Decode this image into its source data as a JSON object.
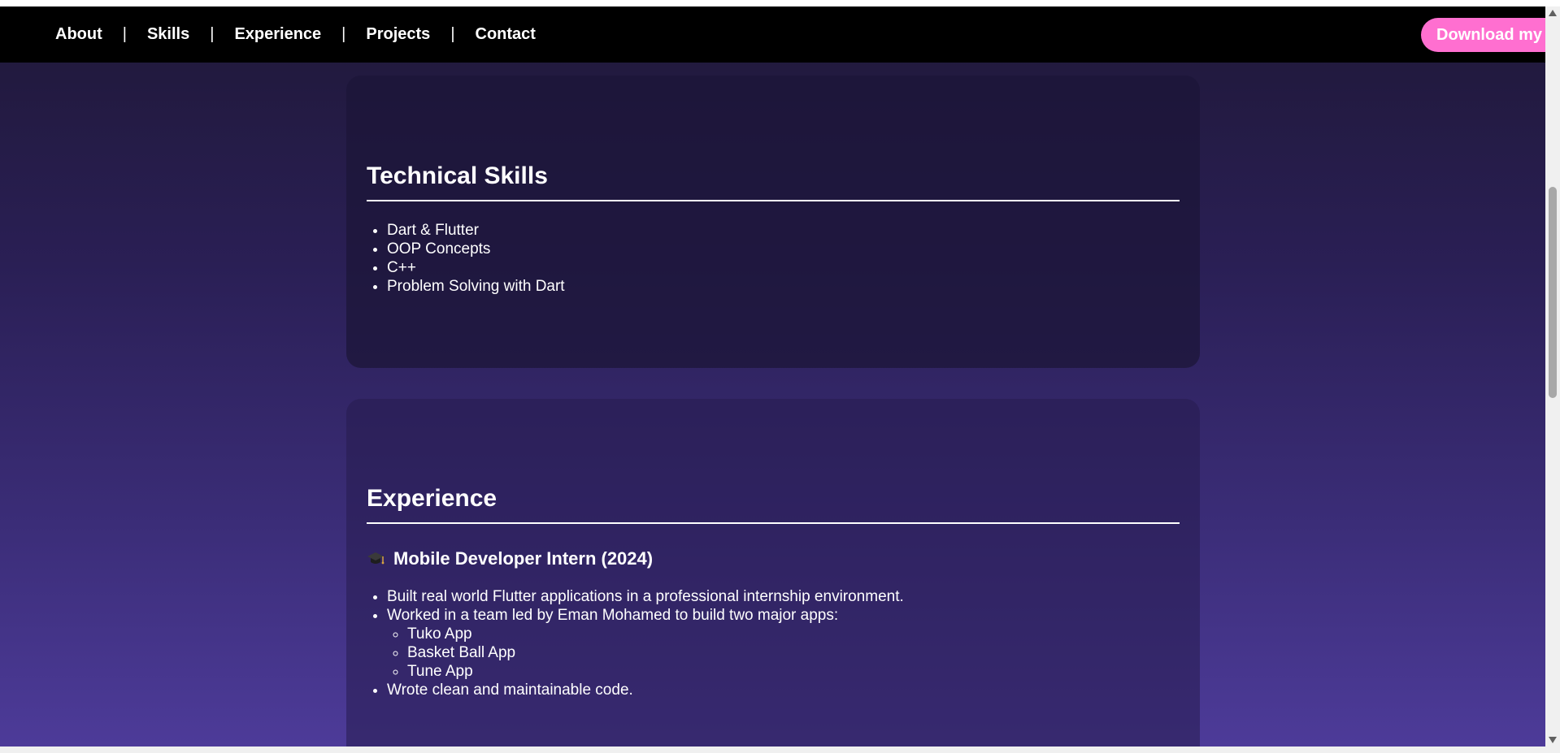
{
  "nav": {
    "items": [
      "About",
      "Skills",
      "Experience",
      "Projects",
      "Contact"
    ],
    "separator": "|",
    "download_label": "Download my"
  },
  "skills": {
    "title": "Technical Skills",
    "items": [
      "Dart & Flutter",
      "OOP Concepts",
      "C++",
      "Problem Solving with Dart"
    ]
  },
  "experience": {
    "title": "Experience",
    "job_icon": "graduation-cap-icon",
    "job_title": "Mobile Developer Intern (2024)",
    "bullets": [
      "Built real world Flutter applications in a professional internship environment.",
      "Worked in a team led by Eman Mohamed to build two major apps:",
      "Wrote clean and maintainable code."
    ],
    "apps": [
      "Tuko App",
      "Basket Ball App",
      "Tune App"
    ]
  },
  "colors": {
    "nav_bg": "#000000",
    "button_bg": "#ff6fd0",
    "page_gradient_top": "#1f1838",
    "page_gradient_bottom": "#4d3b99",
    "text": "#ffffff"
  }
}
